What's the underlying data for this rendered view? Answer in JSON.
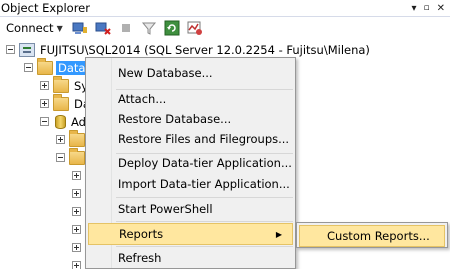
{
  "panel": {
    "title": "Object Explorer",
    "controls": [
      "▾",
      "📌",
      "✕"
    ],
    "toolbar": {
      "connect_label": "Connect",
      "icons": [
        "connect-object-explorer-icon",
        "disconnect-icon",
        "stop-icon",
        "filter-icon",
        "refresh-icon",
        "activity-monitor-icon"
      ]
    }
  },
  "tree": {
    "server_label": "FUJITSU\\SQL2014 (SQL Server 12.0.2254 - Fujitsu\\Milena)",
    "databases_label": "Databa",
    "child_labels": [
      "Sys",
      "Da",
      "Ad"
    ]
  },
  "context_menu": {
    "items": [
      "New Database...",
      "Attach...",
      "Restore Database...",
      "Restore Files and Filegroups...",
      "Deploy Data-tier Application...",
      "Import Data-tier Application...",
      "Start PowerShell",
      "Reports",
      "Refresh"
    ],
    "highlighted": "Reports"
  },
  "submenu": {
    "items": [
      "Custom Reports..."
    ]
  },
  "colors": {
    "selection": "#3399ff",
    "menu_highlight": "#ffe79f",
    "menu_bg": "#f0f0f0"
  }
}
